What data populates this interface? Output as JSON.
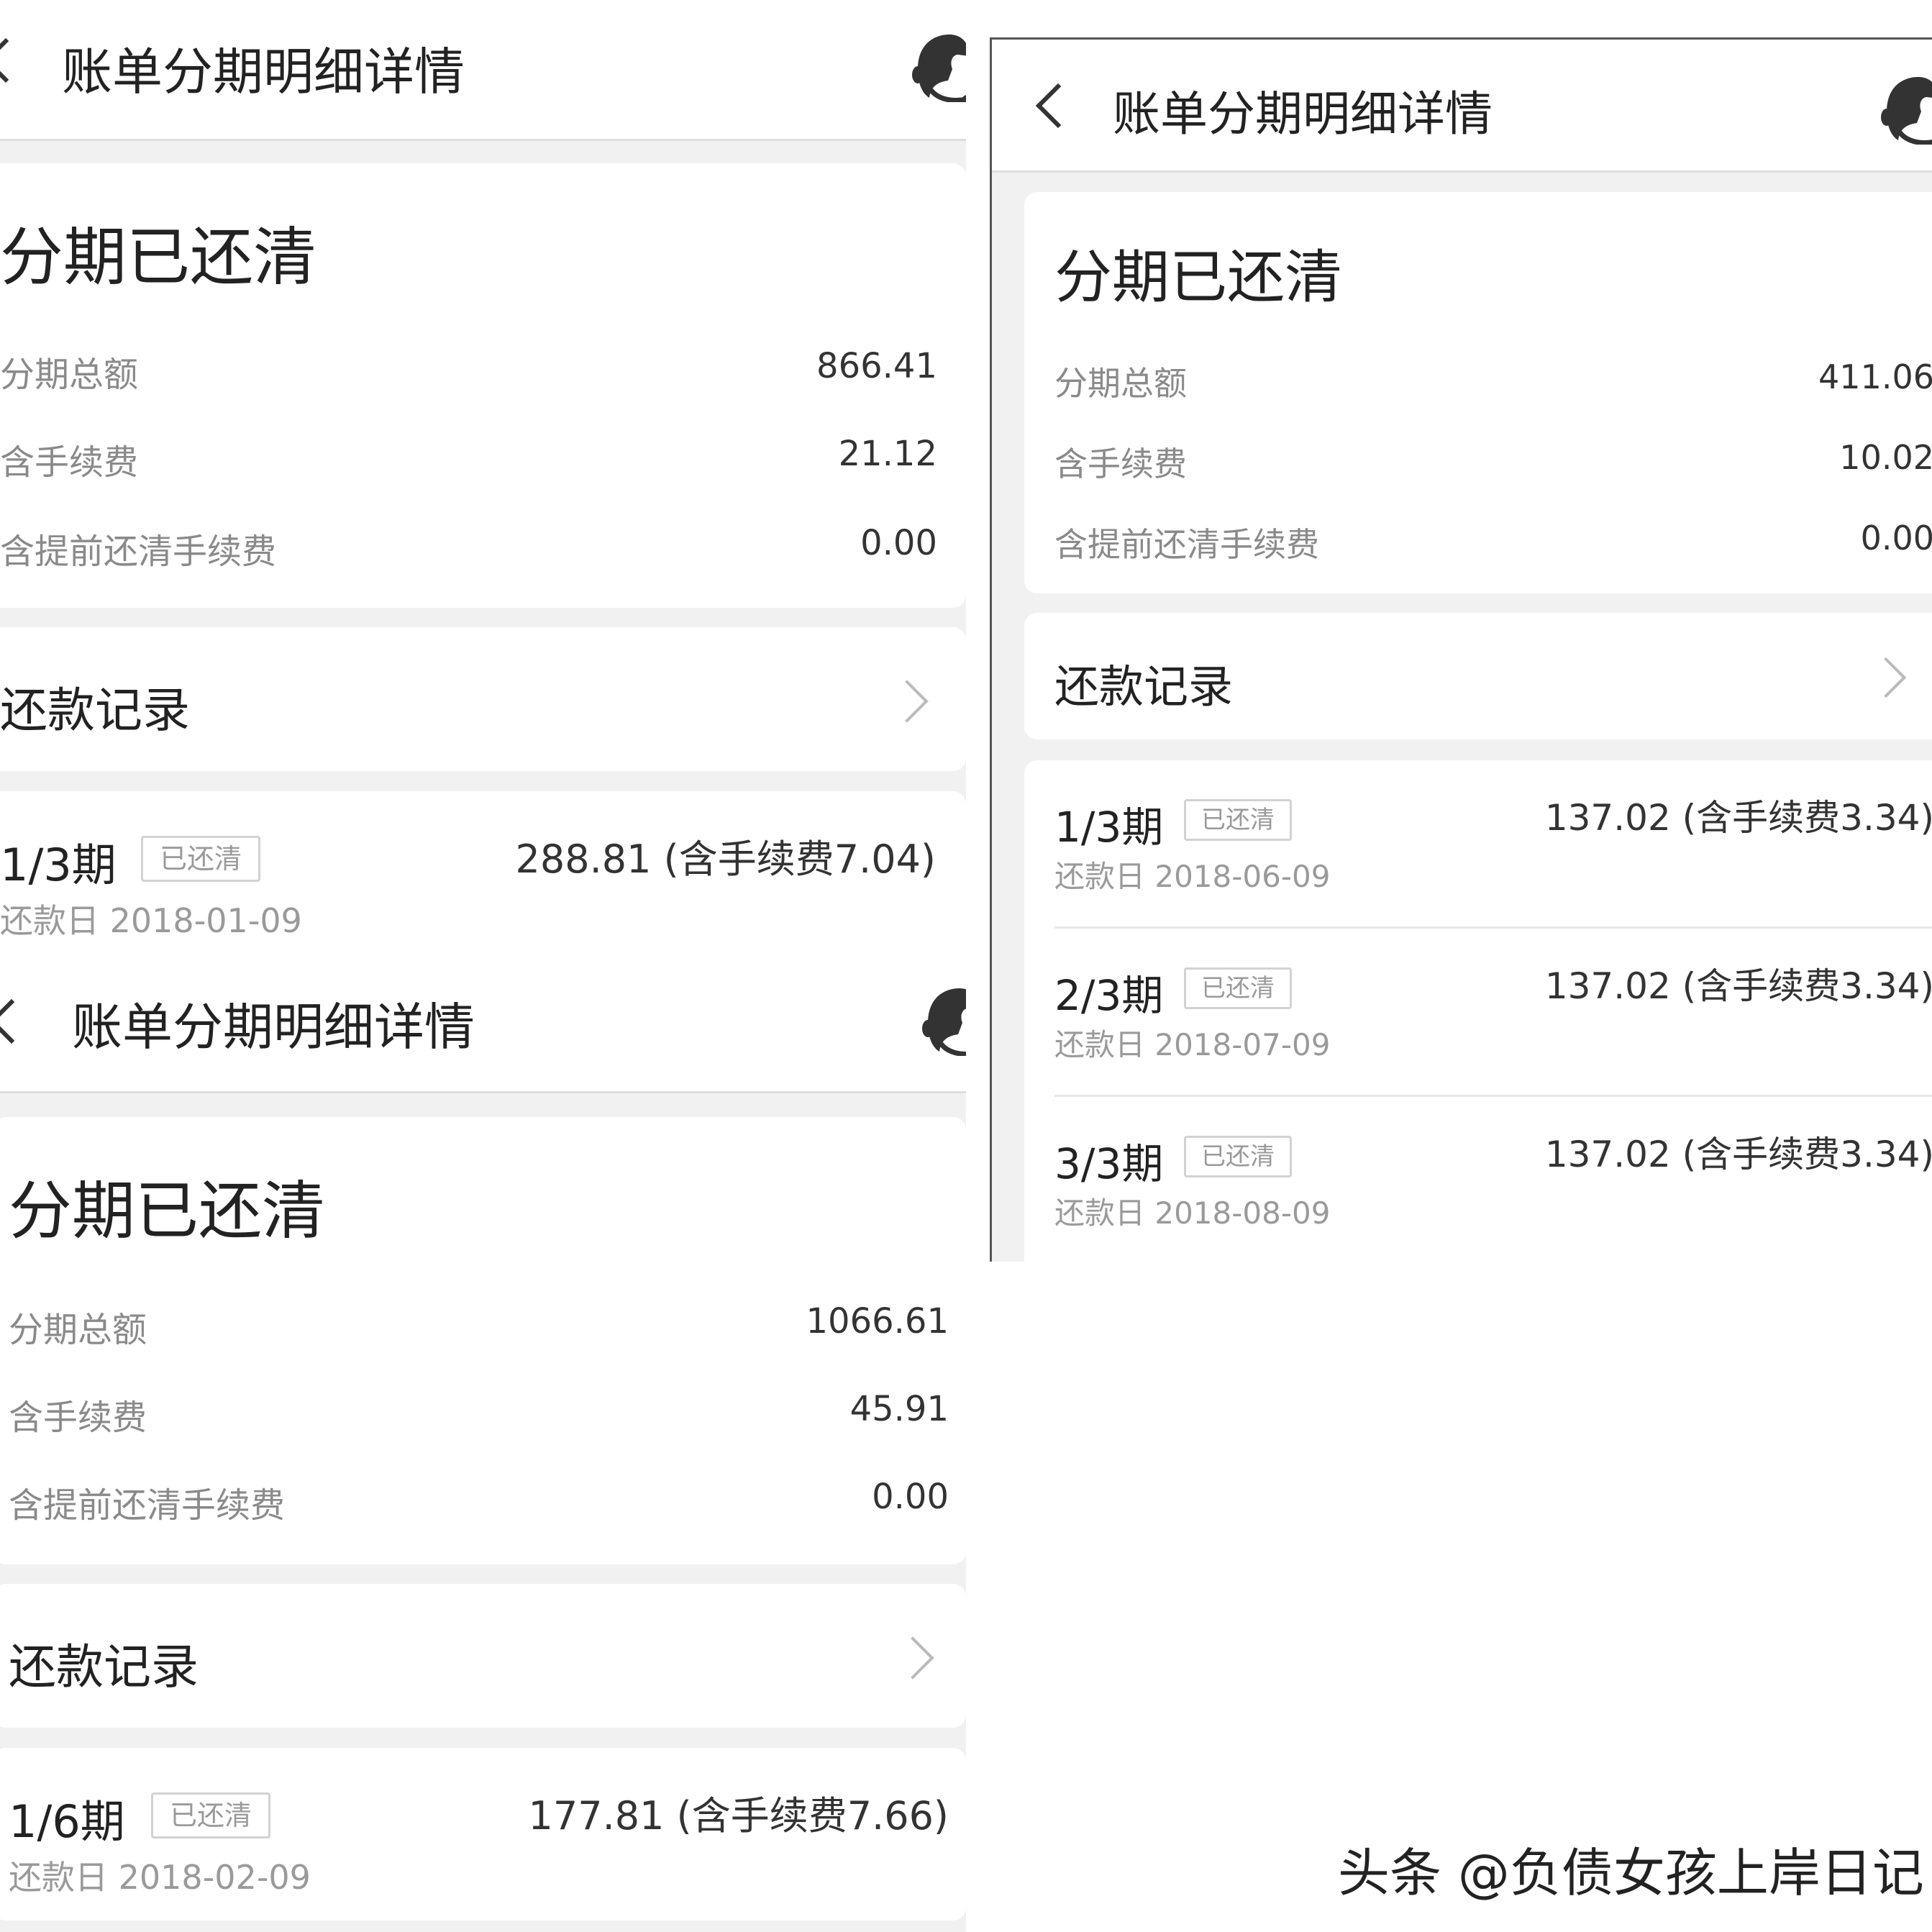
{
  "screenshots": [
    {
      "header": {
        "title": "账单分期明细详情"
      },
      "status": "分期已还清",
      "summary": [
        {
          "label": "分期总额",
          "value": "866.41"
        },
        {
          "label": "含手续费",
          "value": "21.12"
        },
        {
          "label": "含提前还清手续费",
          "value": "0.00"
        }
      ],
      "records_label": "还款记录",
      "installments": [
        {
          "period": "1/3期",
          "badge": "已还清",
          "amount": "288.81 (含手续费7.04)",
          "due": "还款日 2018-01-09"
        }
      ]
    },
    {
      "header": {
        "title": "账单分期明细详情"
      },
      "status": "分期已还清",
      "summary": [
        {
          "label": "分期总额",
          "value": "411.06"
        },
        {
          "label": "含手续费",
          "value": "10.02"
        },
        {
          "label": "含提前还清手续费",
          "value": "0.00"
        }
      ],
      "records_label": "还款记录",
      "installments": [
        {
          "period": "1/3期",
          "badge": "已还清",
          "amount": "137.02 (含手续费3.34)",
          "due": "还款日 2018-06-09"
        },
        {
          "period": "2/3期",
          "badge": "已还清",
          "amount": "137.02 (含手续费3.34)",
          "due": "还款日 2018-07-09"
        },
        {
          "period": "3/3期",
          "badge": "已还清",
          "amount": "137.02 (含手续费3.34)",
          "due": "还款日 2018-08-09"
        }
      ]
    },
    {
      "header": {
        "title": "账单分期明细详情"
      },
      "status": "分期已还清",
      "summary": [
        {
          "label": "分期总额",
          "value": "1066.61"
        },
        {
          "label": "含手续费",
          "value": "45.91"
        },
        {
          "label": "含提前还清手续费",
          "value": "0.00"
        }
      ],
      "records_label": "还款记录",
      "installments": [
        {
          "period": "1/6期",
          "badge": "已还清",
          "amount": "177.81 (含手续费7.66)",
          "due": "还款日 2018-02-09"
        }
      ]
    }
  ],
  "watermark": "头条 @负债女孩上岸日记",
  "icons": {
    "back": "chevron-left-icon",
    "service": "customer-service-icon",
    "arrow": "chevron-right-icon"
  },
  "colors": {
    "background": "#f1f1f1",
    "card": "#ffffff",
    "label": "#8a8a8a",
    "badge_border": "#d2d2d2"
  }
}
